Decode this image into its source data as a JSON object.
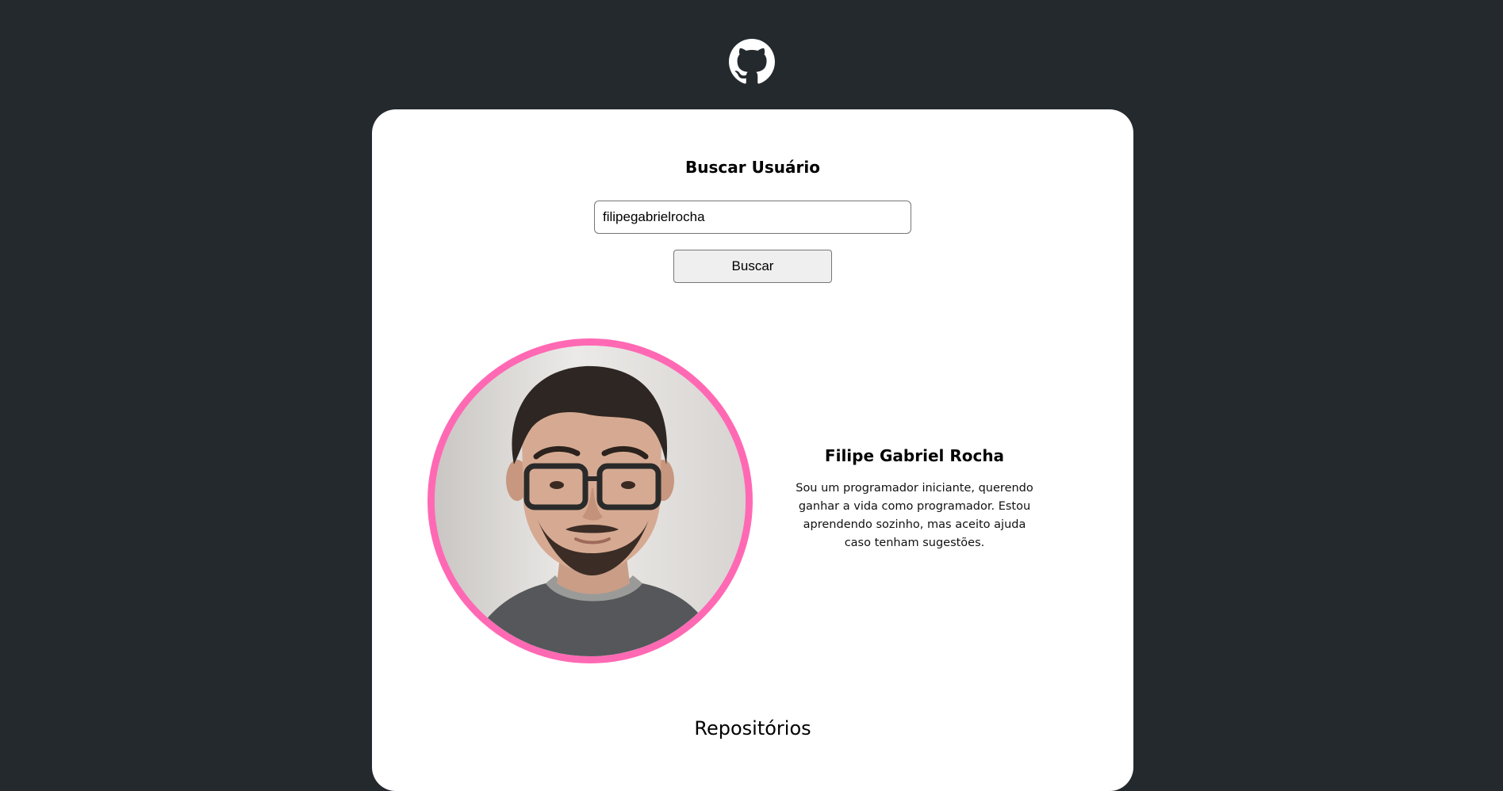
{
  "header": {
    "logo_icon": "github-octocat-icon"
  },
  "search": {
    "title": "Buscar Usuário",
    "input_value": "filipegabrielrocha",
    "button_label": "Buscar"
  },
  "profile": {
    "avatar_icon": "user-photo",
    "avatar_border_color": "#ff69b4",
    "name": "Filipe Gabriel Rocha",
    "bio": "Sou um programador iniciante, querendo ganhar a vida como programador. Estou aprendendo sozinho, mas aceito ajuda caso tenham sugestões."
  },
  "repositories": {
    "title": "Repositórios"
  },
  "colors": {
    "background": "#24292e",
    "card": "#ffffff",
    "accent": "#ff69b4"
  }
}
